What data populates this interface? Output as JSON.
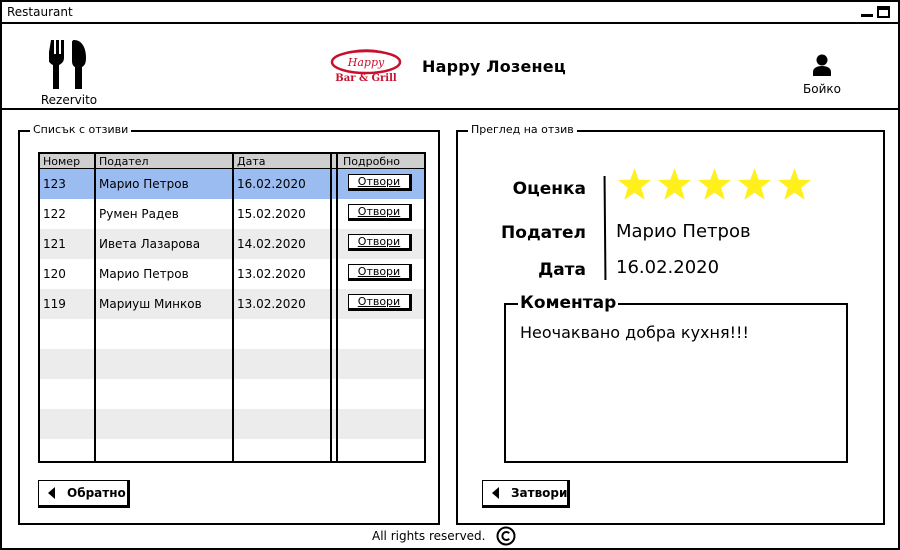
{
  "window": {
    "title": "Restaurant"
  },
  "header": {
    "app_name": "Rezervito",
    "logo_text_top": "Happy",
    "logo_text_bottom": "Bar & Grill",
    "restaurant_name": "Happy Лозенец",
    "user_name": "Бойко"
  },
  "reviews_panel": {
    "title": "Списък с отзиви",
    "columns": [
      "Номер",
      "Подател",
      "Дата",
      "Подробно"
    ],
    "rows": [
      {
        "id": "123",
        "author": "Марио Петров",
        "date": "16.02.2020",
        "action": "Отвори"
      },
      {
        "id": "122",
        "author": "Румен Радев",
        "date": "15.02.2020",
        "action": "Отвори"
      },
      {
        "id": "121",
        "author": "Ивета Лазарова",
        "date": "14.02.2020",
        "action": "Отвори"
      },
      {
        "id": "120",
        "author": "Марио Петров",
        "date": "13.02.2020",
        "action": "Отвори"
      },
      {
        "id": "119",
        "author": "Мариуш Минков",
        "date": "13.02.2020",
        "action": "Отвори"
      }
    ],
    "back_label": "Обратно"
  },
  "review_detail": {
    "title": "Преглед на отзив",
    "rating_label": "Оценка",
    "rating": 5,
    "rating_max": 5,
    "star_color": "#ffef1d",
    "author_label": "Подател",
    "author": "Марио Петров",
    "date_label": "Дата",
    "date": "16.02.2020",
    "comment_label": "Коментар",
    "comment": "Неочаквано добра кухня!!!",
    "close_label": "Затвори"
  },
  "footer": {
    "text": "All rights reserved.",
    "icon": "copyright-icon"
  },
  "colors": {
    "selected_row": "#9bbcf0",
    "alt_row": "#ececec",
    "header_row": "#cfcfcf",
    "logo_red": "#c8102e"
  }
}
